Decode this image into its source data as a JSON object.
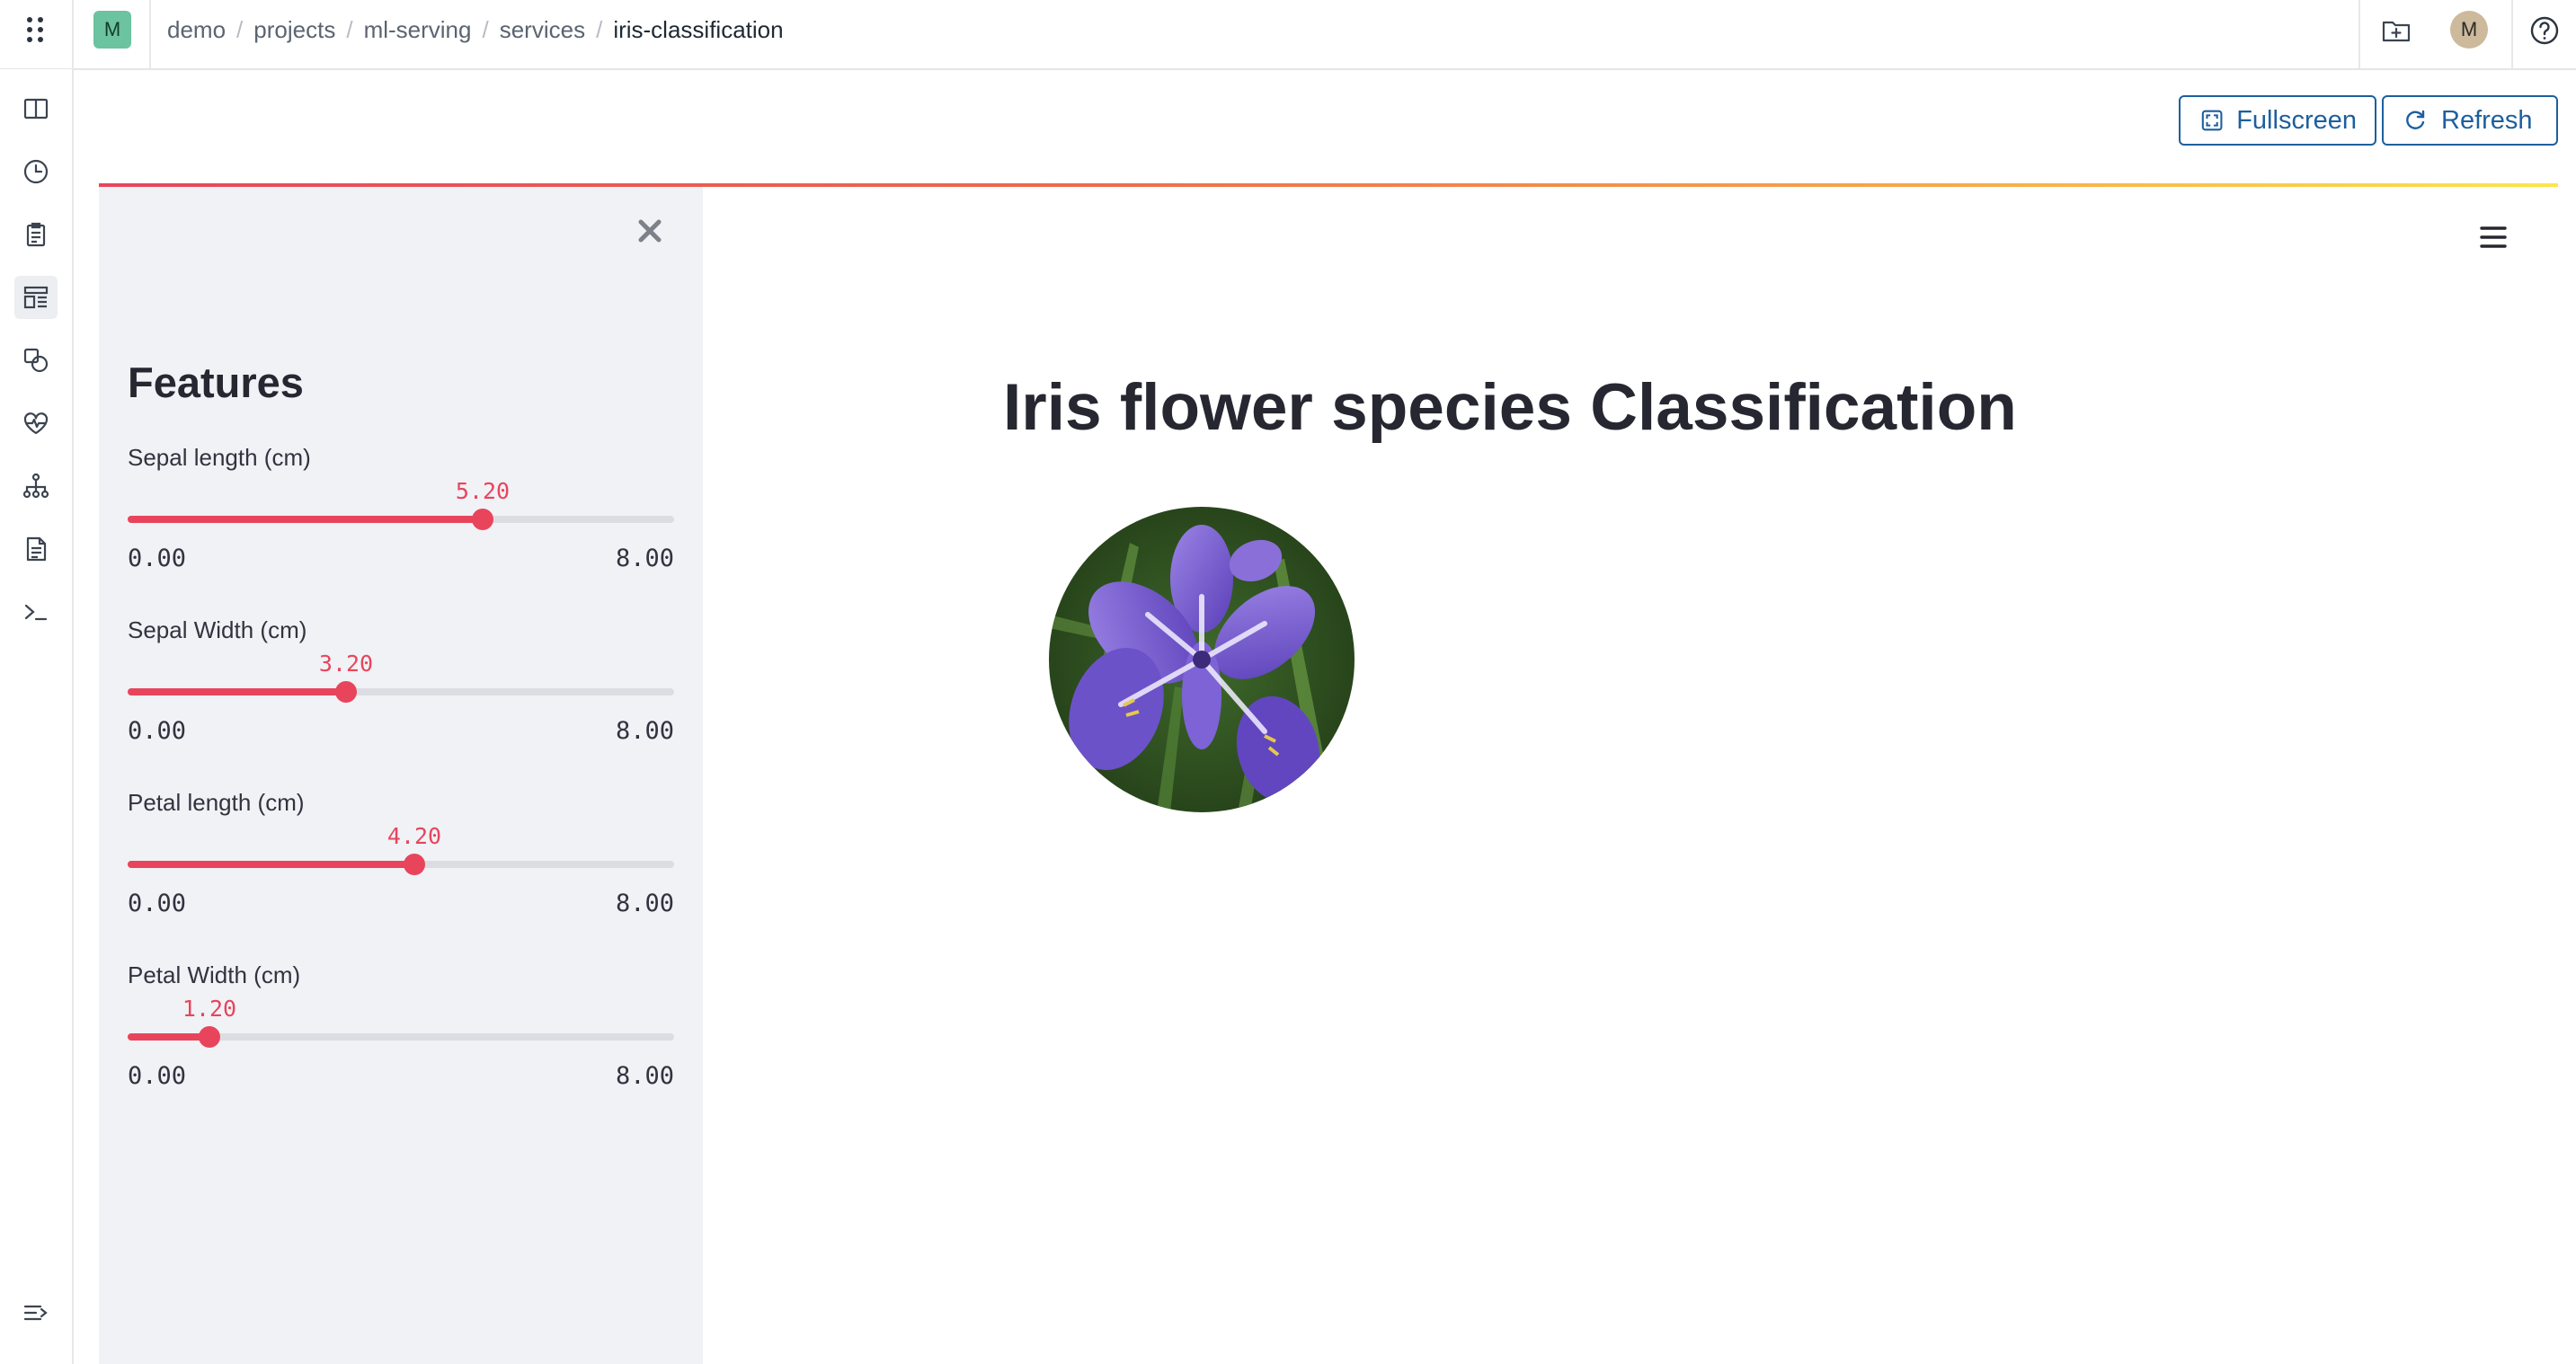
{
  "topbar": {
    "project_initial": "M",
    "breadcrumb": [
      "demo",
      "projects",
      "ml-serving",
      "services"
    ],
    "current_page": "iris-classification",
    "user_initial": "M"
  },
  "icons": {
    "apps": "grid-dots-icon",
    "new_folder": "folder-add-icon",
    "help": "help-circle-icon",
    "rail": [
      "panel-icon",
      "clock-icon",
      "clipboard-icon",
      "dashboard-icon",
      "shapes-icon",
      "heart-monitor-icon",
      "hierarchy-icon",
      "document-icon",
      "terminal-icon",
      "expand-menu-icon"
    ]
  },
  "toolbar": {
    "fullscreen_label": "Fullscreen",
    "refresh_label": "Refresh"
  },
  "sidebar": {
    "title": "Features",
    "sliders": [
      {
        "label": "Sepal length (cm)",
        "value": "5.20",
        "min": "0.00",
        "max": "8.00",
        "fraction": 0.65
      },
      {
        "label": "Sepal Width (cm)",
        "value": "3.20",
        "min": "0.00",
        "max": "8.00",
        "fraction": 0.4
      },
      {
        "label": "Petal length (cm)",
        "value": "4.20",
        "min": "0.00",
        "max": "8.00",
        "fraction": 0.525
      },
      {
        "label": "Petal Width (cm)",
        "value": "1.20",
        "min": "0.00",
        "max": "8.00",
        "fraction": 0.15
      }
    ]
  },
  "main": {
    "title": "Iris flower species Classification"
  },
  "colors": {
    "accent": "#e8455c",
    "button_blue": "#1d5f9e",
    "sidebar_bg": "#f0f2f6",
    "project_badge": "#6cc3a0"
  }
}
